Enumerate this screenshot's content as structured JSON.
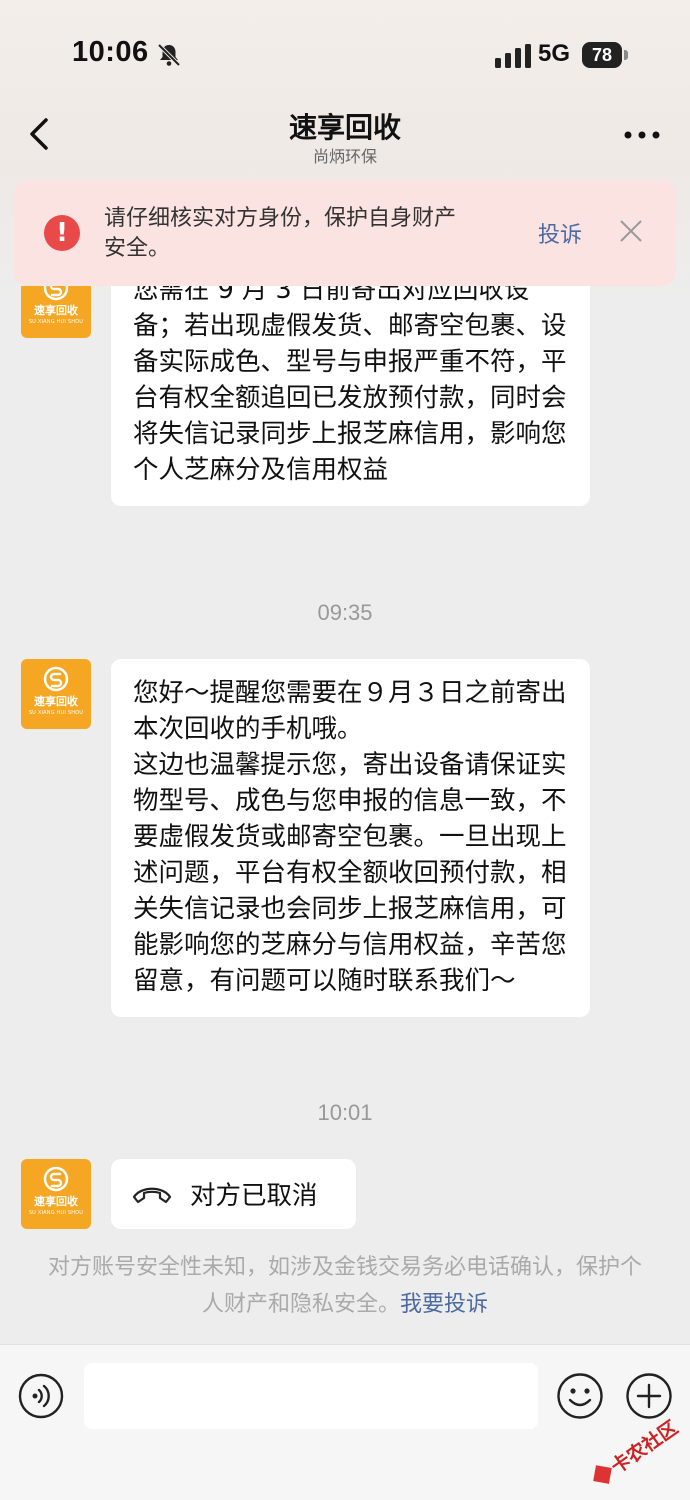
{
  "status_bar": {
    "time": "10:06",
    "network": "5G",
    "battery": "78"
  },
  "nav": {
    "title": "速享回收",
    "subtitle": "尚炳环保"
  },
  "banner": {
    "text": "请仔细核实对方身份，保护自身财产安全。",
    "complain_label": "投诉"
  },
  "avatar": {
    "brand_name": "速享回收",
    "brand_pinyin": "SU XIANG HUI SHOU"
  },
  "messages": [
    {
      "type": "text",
      "text": "您需在 9 月 3 日前寄出对应回收设备；若出现虚假发货、邮寄空包裹、设备实际成色、型号与申报严重不符，平台有权全额追回已发放预付款，同时会将失信记录同步上报芝麻信用，影响您个人芝麻分及信用权益"
    },
    {
      "type": "time",
      "text": "09:35"
    },
    {
      "type": "text",
      "text": "您好～提醒您需要在９月３日之前寄出本次回收的手机哦。\n这边也温馨提示您，寄出设备请保证实物型号、成色与您申报的信息一致，不要虚假发货或邮寄空包裹。一旦出现上述问题，平台有权全额收回预付款，相关失信记录也会同步上报芝麻信用，可能影响您的芝麻分与信用权益，辛苦您留意，有问题可以随时联系我们～"
    },
    {
      "type": "time",
      "text": "10:01"
    },
    {
      "type": "call",
      "text": "对方已取消"
    }
  ],
  "notice": {
    "text": "对方账号安全性未知，如涉及金钱交易务必电话确认，保护个人财产和隐私安全。",
    "link": "我要投诉"
  },
  "input": {
    "placeholder": ""
  },
  "watermark": {
    "text": "卡农社区"
  },
  "colors": {
    "accent_orange": "#f5a623",
    "warning_red": "#e84a4a",
    "link_blue": "#4a6aa0"
  }
}
